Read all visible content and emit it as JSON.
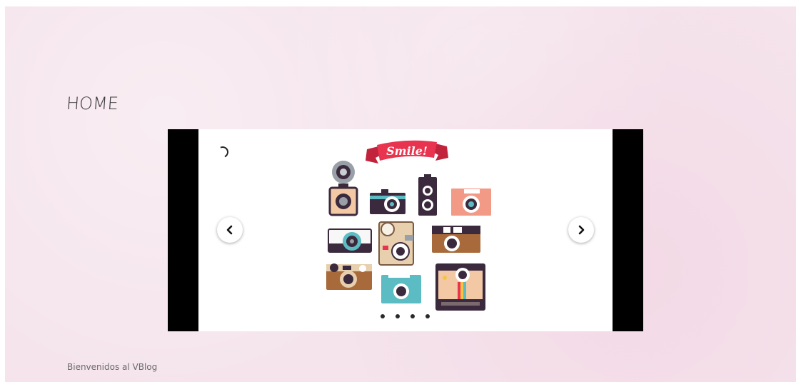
{
  "header": {
    "title": "HOME"
  },
  "slider": {
    "banner_text": "Smile!",
    "slide_count": 4,
    "active_slide": 1,
    "prev_icon": "chevron-left-icon",
    "next_icon": "chevron-right-icon",
    "loading_icon": "spinner-icon",
    "image_subject": "vintage camera icons"
  },
  "footer": {
    "text": "Bienvenidos al VBlog"
  },
  "colors": {
    "background": "#f5e4ec",
    "slider_frame": "#000000",
    "banner_red": "#e8344e",
    "camera_dark": "#3b2a3d",
    "camera_teal": "#5bbcc4",
    "camera_peach": "#f29a86",
    "camera_brown": "#a86a3a"
  }
}
